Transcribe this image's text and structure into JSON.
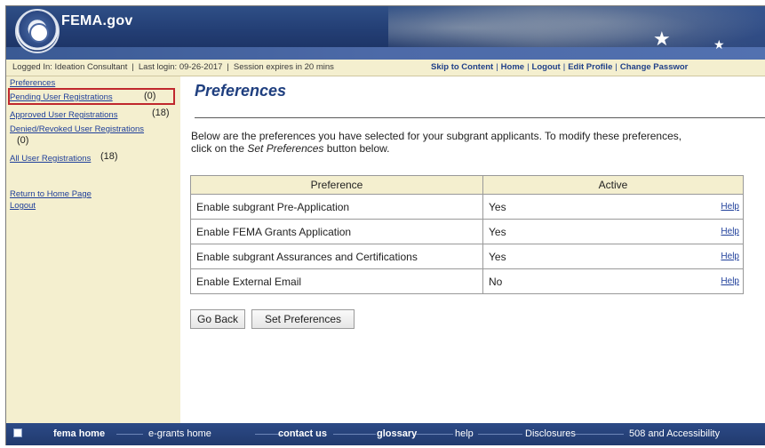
{
  "header": {
    "brand": "FEMA.gov",
    "logo_icon": "dhs-seal-icon",
    "accent_colors": {
      "banner": "#233e74",
      "panel": "#f4efcf",
      "link": "#1f3f9a",
      "highlight": "#c0282d"
    }
  },
  "status_bar": {
    "logged_in": "Logged In: Ideation Consultant",
    "last_login": "Last login: 09-26-2017",
    "session": "Session expires in 20 mins",
    "links": [
      "Skip to Content",
      "Home",
      "Logout",
      "Edit Profile",
      "Change Passwor"
    ]
  },
  "sidebar": {
    "items": [
      {
        "label": "Preferences",
        "count": ""
      },
      {
        "label": "Pending User Registrations",
        "count": "(0)"
      },
      {
        "label": "Approved User Registrations",
        "count": "(18)"
      },
      {
        "label": "Denied/Revoked User Registrations",
        "count": "(0)"
      },
      {
        "label": "All User Registrations",
        "count": "(18)"
      }
    ],
    "links": [
      "Return to Home Page",
      "Logout"
    ]
  },
  "main": {
    "title": "Preferences",
    "intro_line1": "Below are the preferences you have selected for your subgrant applicants. To modify these preferences,",
    "intro_line2_before": "click on the ",
    "intro_line2_em": "Set Preferences",
    "intro_line2_after": " button below.",
    "table": {
      "headers": [
        "Preference",
        "Active"
      ],
      "rows": [
        {
          "preference": "Enable subgrant Pre-Application",
          "active": "Yes",
          "help": "Help"
        },
        {
          "preference": "Enable FEMA Grants Application",
          "active": "Yes",
          "help": "Help"
        },
        {
          "preference": "Enable subgrant Assurances and Certifications",
          "active": "Yes",
          "help": "Help"
        },
        {
          "preference": "Enable External Email",
          "active": "No",
          "help": "Help"
        }
      ]
    },
    "buttons": {
      "back": "Go Back",
      "set": "Set Preferences"
    }
  },
  "footer": {
    "items": [
      "fema home",
      "e-grants home",
      "contact us",
      "glossary",
      "help",
      "Disclosures",
      "508 and Accessibility"
    ]
  }
}
